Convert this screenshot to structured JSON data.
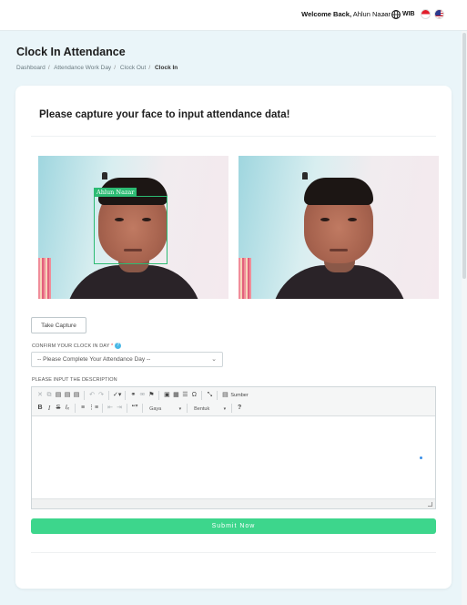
{
  "topbar": {
    "welcome_bold": "Welcome Back,",
    "user_name": "Ahlun Nazar",
    "timezone": "WIB"
  },
  "page": {
    "title": "Clock In Attendance",
    "breadcrumb": [
      "Dashboard",
      "Attendance Work Day",
      "Clock Out",
      "Clock In"
    ]
  },
  "card": {
    "heading": "Please capture your face to input attendance data!",
    "face_tag": "Ahlun Nazar",
    "capture_label": "Take Capture",
    "confirm_label": "CONFIRM YOUR CLOCK IN DAY",
    "confirm_required": "*",
    "help_icon": "?",
    "select_value": "-- Please Complete Your Attendance Day --",
    "description_label": "PLEASE INPUT THE DESCRIPTION",
    "editor": {
      "source_label": "Sumber",
      "style_combo": "Gaya",
      "format_combo": "Bentuk",
      "help": "?"
    },
    "submit_label": "Submit Now"
  },
  "colors": {
    "accent": "#3dd68c",
    "face_box": "#2cbb73",
    "background": "#eaf5f9"
  }
}
